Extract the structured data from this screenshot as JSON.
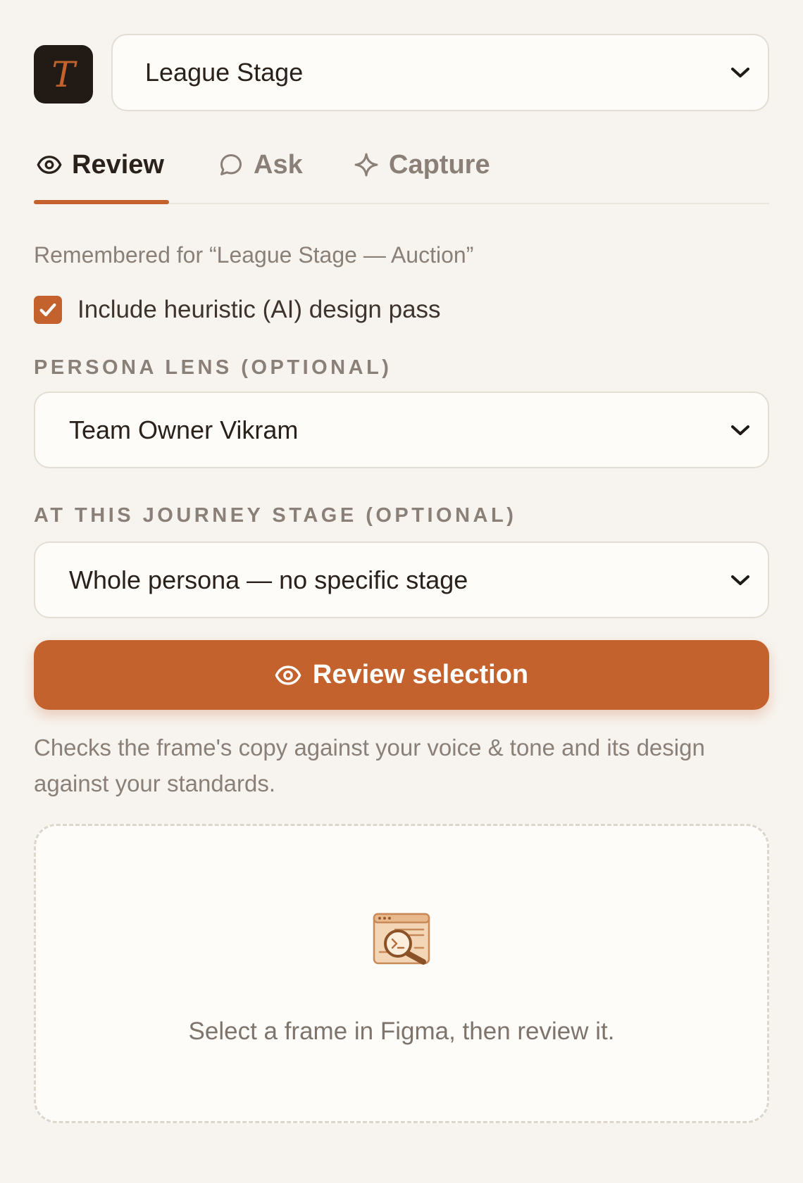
{
  "app": {
    "logo_letter": "T",
    "project_select": {
      "value": "League Stage"
    }
  },
  "tabs": [
    {
      "label": "Review",
      "icon": "eye-icon",
      "active": true
    },
    {
      "label": "Ask",
      "icon": "speech-bubble-icon",
      "active": false
    },
    {
      "label": "Capture",
      "icon": "sparkle-icon",
      "active": false
    }
  ],
  "review": {
    "remembered_text": "Remembered for “League Stage — Auction”",
    "heuristic_checkbox": {
      "label": "Include heuristic (AI) design pass",
      "checked": true
    },
    "persona": {
      "label": "PERSONA LENS (OPTIONAL)",
      "value": "Team Owner Vikram"
    },
    "stage": {
      "label": "AT THIS JOURNEY STAGE (OPTIONAL)",
      "value": "Whole persona — no specific stage"
    },
    "review_button": {
      "label": "Review selection",
      "icon": "eye-icon"
    },
    "helper_text": "Checks the frame's copy against your voice & tone and its design against your standards.",
    "empty_state": {
      "icon": "magnifier-document-icon",
      "text": "Select a frame in Figma, then review it."
    }
  },
  "colors": {
    "accent": "#c4622e",
    "background": "#f7f4ef",
    "surface": "#fdfcf9",
    "muted_text": "#8a8078",
    "logo_bg": "#211a15"
  }
}
